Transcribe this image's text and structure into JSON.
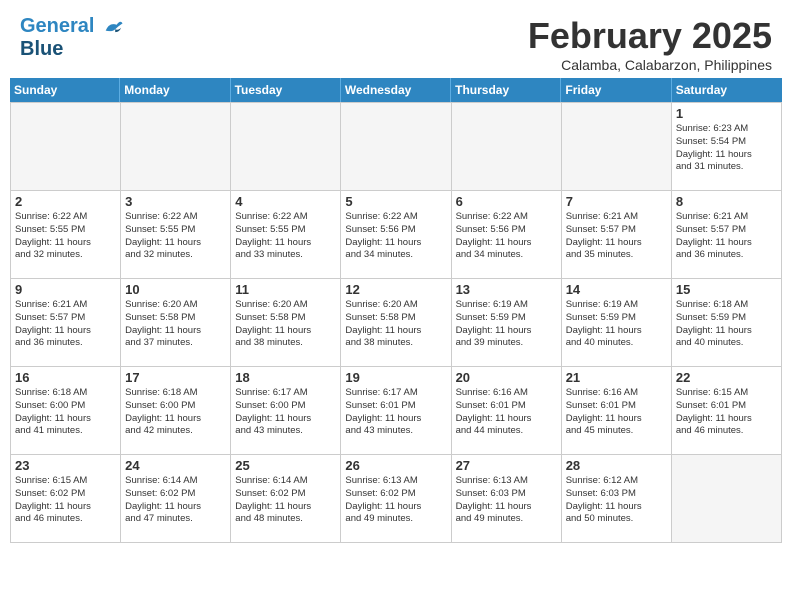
{
  "header": {
    "logo_line1": "General",
    "logo_line2": "Blue",
    "month_title": "February 2025",
    "location": "Calamba, Calabarzon, Philippines"
  },
  "day_headers": [
    "Sunday",
    "Monday",
    "Tuesday",
    "Wednesday",
    "Thursday",
    "Friday",
    "Saturday"
  ],
  "weeks": [
    [
      {
        "day": "",
        "info": "",
        "empty": true
      },
      {
        "day": "",
        "info": "",
        "empty": true
      },
      {
        "day": "",
        "info": "",
        "empty": true
      },
      {
        "day": "",
        "info": "",
        "empty": true
      },
      {
        "day": "",
        "info": "",
        "empty": true
      },
      {
        "day": "",
        "info": "",
        "empty": true
      },
      {
        "day": "1",
        "info": "Sunrise: 6:23 AM\nSunset: 5:54 PM\nDaylight: 11 hours\nand 31 minutes."
      }
    ],
    [
      {
        "day": "2",
        "info": "Sunrise: 6:22 AM\nSunset: 5:55 PM\nDaylight: 11 hours\nand 32 minutes."
      },
      {
        "day": "3",
        "info": "Sunrise: 6:22 AM\nSunset: 5:55 PM\nDaylight: 11 hours\nand 32 minutes."
      },
      {
        "day": "4",
        "info": "Sunrise: 6:22 AM\nSunset: 5:55 PM\nDaylight: 11 hours\nand 33 minutes."
      },
      {
        "day": "5",
        "info": "Sunrise: 6:22 AM\nSunset: 5:56 PM\nDaylight: 11 hours\nand 34 minutes."
      },
      {
        "day": "6",
        "info": "Sunrise: 6:22 AM\nSunset: 5:56 PM\nDaylight: 11 hours\nand 34 minutes."
      },
      {
        "day": "7",
        "info": "Sunrise: 6:21 AM\nSunset: 5:57 PM\nDaylight: 11 hours\nand 35 minutes."
      },
      {
        "day": "8",
        "info": "Sunrise: 6:21 AM\nSunset: 5:57 PM\nDaylight: 11 hours\nand 36 minutes."
      }
    ],
    [
      {
        "day": "9",
        "info": "Sunrise: 6:21 AM\nSunset: 5:57 PM\nDaylight: 11 hours\nand 36 minutes."
      },
      {
        "day": "10",
        "info": "Sunrise: 6:20 AM\nSunset: 5:58 PM\nDaylight: 11 hours\nand 37 minutes."
      },
      {
        "day": "11",
        "info": "Sunrise: 6:20 AM\nSunset: 5:58 PM\nDaylight: 11 hours\nand 38 minutes."
      },
      {
        "day": "12",
        "info": "Sunrise: 6:20 AM\nSunset: 5:58 PM\nDaylight: 11 hours\nand 38 minutes."
      },
      {
        "day": "13",
        "info": "Sunrise: 6:19 AM\nSunset: 5:59 PM\nDaylight: 11 hours\nand 39 minutes."
      },
      {
        "day": "14",
        "info": "Sunrise: 6:19 AM\nSunset: 5:59 PM\nDaylight: 11 hours\nand 40 minutes."
      },
      {
        "day": "15",
        "info": "Sunrise: 6:18 AM\nSunset: 5:59 PM\nDaylight: 11 hours\nand 40 minutes."
      }
    ],
    [
      {
        "day": "16",
        "info": "Sunrise: 6:18 AM\nSunset: 6:00 PM\nDaylight: 11 hours\nand 41 minutes."
      },
      {
        "day": "17",
        "info": "Sunrise: 6:18 AM\nSunset: 6:00 PM\nDaylight: 11 hours\nand 42 minutes."
      },
      {
        "day": "18",
        "info": "Sunrise: 6:17 AM\nSunset: 6:00 PM\nDaylight: 11 hours\nand 43 minutes."
      },
      {
        "day": "19",
        "info": "Sunrise: 6:17 AM\nSunset: 6:01 PM\nDaylight: 11 hours\nand 43 minutes."
      },
      {
        "day": "20",
        "info": "Sunrise: 6:16 AM\nSunset: 6:01 PM\nDaylight: 11 hours\nand 44 minutes."
      },
      {
        "day": "21",
        "info": "Sunrise: 6:16 AM\nSunset: 6:01 PM\nDaylight: 11 hours\nand 45 minutes."
      },
      {
        "day": "22",
        "info": "Sunrise: 6:15 AM\nSunset: 6:01 PM\nDaylight: 11 hours\nand 46 minutes."
      }
    ],
    [
      {
        "day": "23",
        "info": "Sunrise: 6:15 AM\nSunset: 6:02 PM\nDaylight: 11 hours\nand 46 minutes."
      },
      {
        "day": "24",
        "info": "Sunrise: 6:14 AM\nSunset: 6:02 PM\nDaylight: 11 hours\nand 47 minutes."
      },
      {
        "day": "25",
        "info": "Sunrise: 6:14 AM\nSunset: 6:02 PM\nDaylight: 11 hours\nand 48 minutes."
      },
      {
        "day": "26",
        "info": "Sunrise: 6:13 AM\nSunset: 6:02 PM\nDaylight: 11 hours\nand 49 minutes."
      },
      {
        "day": "27",
        "info": "Sunrise: 6:13 AM\nSunset: 6:03 PM\nDaylight: 11 hours\nand 49 minutes."
      },
      {
        "day": "28",
        "info": "Sunrise: 6:12 AM\nSunset: 6:03 PM\nDaylight: 11 hours\nand 50 minutes."
      },
      {
        "day": "",
        "info": "",
        "empty": true
      }
    ]
  ]
}
